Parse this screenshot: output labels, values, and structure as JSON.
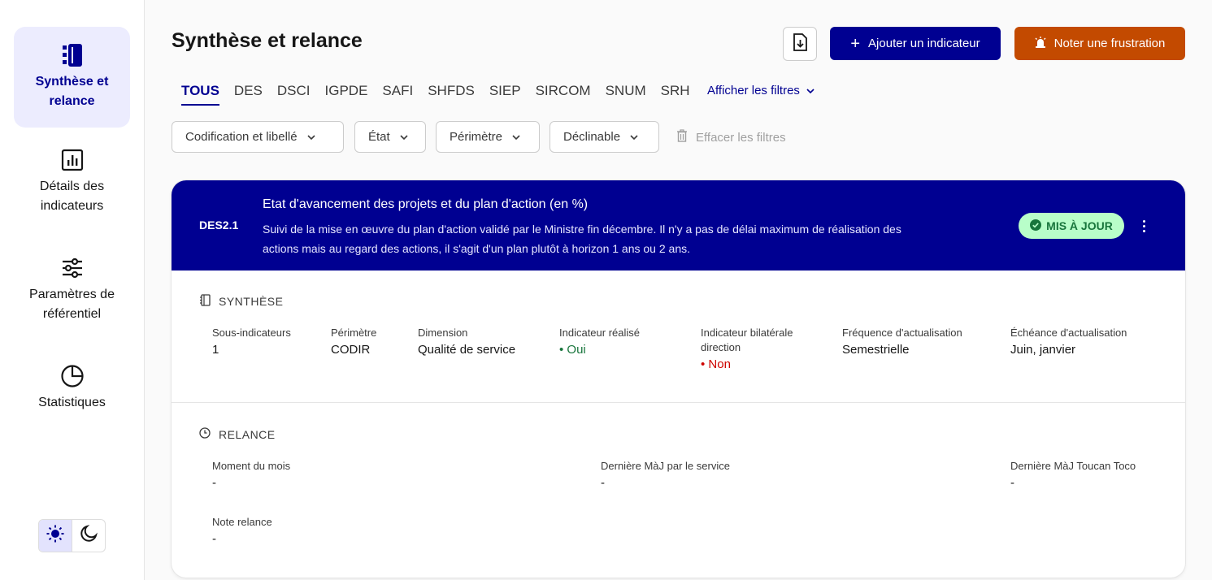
{
  "sidebar": {
    "items": [
      {
        "label": "Synthèse et relance",
        "icon": "notebook-icon"
      },
      {
        "label": "Détails des indicateurs",
        "icon": "bar-chart-icon"
      },
      {
        "label": "Paramètres de référentiel",
        "icon": "sliders-icon"
      },
      {
        "label": "Statistiques",
        "icon": "pie-chart-icon"
      }
    ],
    "theme": {
      "light_icon": "sun-icon",
      "dark_icon": "moon-icon",
      "selected": "light"
    }
  },
  "header": {
    "title": "Synthèse et relance",
    "export_icon": "download-file-icon",
    "add_button": "Ajouter un indicateur",
    "frustration_button": "Noter une frustration"
  },
  "tabs": [
    "TOUS",
    "DES",
    "DSCI",
    "IGPDE",
    "SAFI",
    "SHFDS",
    "SIEP",
    "SIRCOM",
    "SNUM",
    "SRH"
  ],
  "active_tab": "TOUS",
  "show_filters": "Afficher les filtres",
  "filters": [
    "Codification et libellé",
    "État",
    "Périmètre",
    "Déclinable"
  ],
  "clear_filters": "Effacer les filtres",
  "card": {
    "code": "DES2.1",
    "title": "Etat d'avancement des projets et du plan d'action (en %)",
    "description": "Suivi de la mise en œuvre du plan d'action validé par le Ministre fin décembre. Il n'y a pas de délai maximum de réalisation des actions mais au regard des actions, il s'agit d'un plan plutôt à horizon 1 ans ou 2 ans.",
    "status": "MIS À JOUR",
    "synthese": {
      "label": "SYNTHÈSE",
      "fields": [
        {
          "key": "Sous-indicateurs",
          "value": "1"
        },
        {
          "key": "Périmètre",
          "value": "CODIR"
        },
        {
          "key": "Dimension",
          "value": "Qualité de service"
        },
        {
          "key": "Indicateur réalisé",
          "value": "• Oui"
        },
        {
          "key": "Indicateur bilatérale direction",
          "value": "• Non"
        },
        {
          "key": "Fréquence d'actualisation",
          "value": "Semestrielle"
        },
        {
          "key": "Échéance d'actualisation",
          "value": "Juin, janvier"
        }
      ]
    },
    "relance": {
      "label": "RELANCE",
      "fields": [
        {
          "key": "Moment du mois",
          "value": "-"
        },
        {
          "key": "Dernière MàJ par le service",
          "value": "-"
        },
        {
          "key": "Dernière MàJ Toucan Toco",
          "value": "-"
        },
        {
          "key": "Note relance",
          "value": "-"
        }
      ]
    }
  }
}
